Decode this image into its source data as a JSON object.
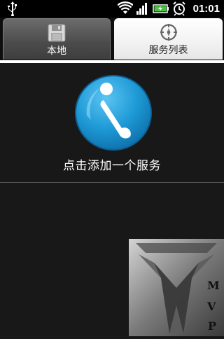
{
  "status_bar": {
    "time": "01:01",
    "icons": [
      "usb-icon",
      "wifi-icon",
      "signal-icon",
      "battery-charging-icon",
      "alarm-clock-icon"
    ]
  },
  "tabs": [
    {
      "label": "本地",
      "icon": "floppy-disk-icon",
      "selected": false
    },
    {
      "label": "服务列表",
      "icon": "compass-icon",
      "selected": true
    }
  ],
  "main": {
    "add_service_label": "点击添加一个服务",
    "icon": "info-icon"
  },
  "watermark": {
    "text": "MVP"
  },
  "colors": {
    "info_blue": "#1e9ad6",
    "tab_selected_bg": "#ffffff",
    "tab_unselected_bg": "#555555",
    "background": "#181818"
  }
}
